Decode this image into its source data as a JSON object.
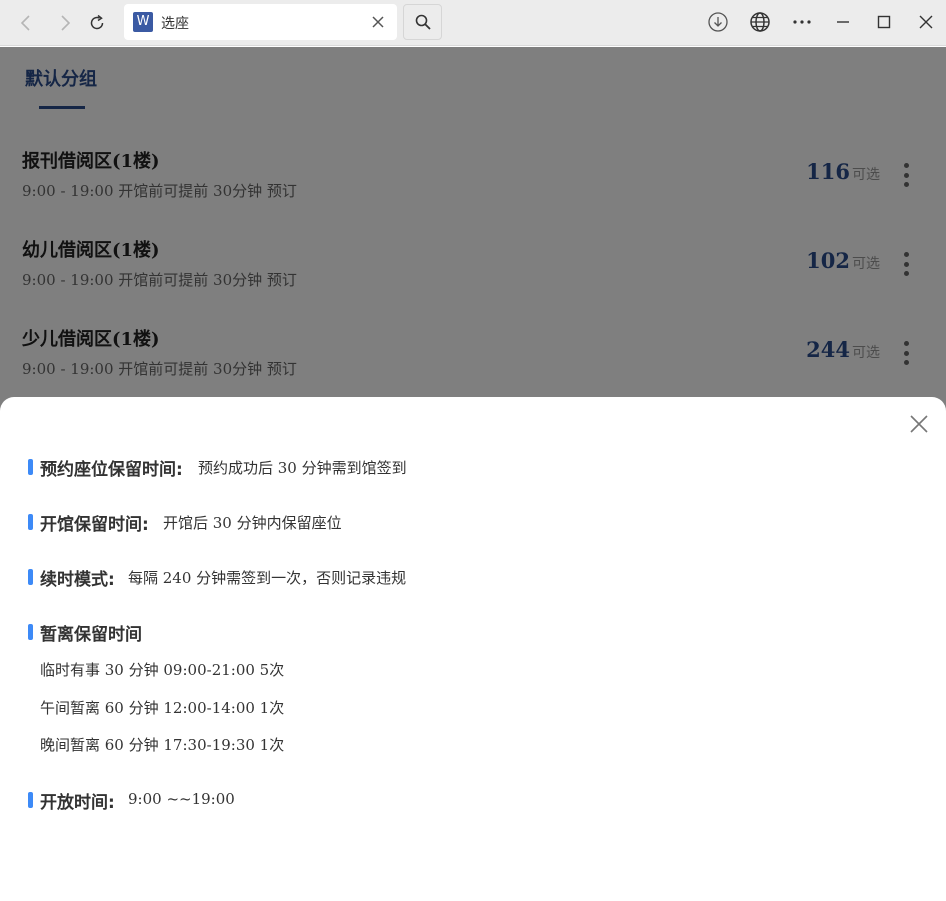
{
  "browser": {
    "tab_title": "选座",
    "favicon_text": "W",
    "icons": {
      "back": "chevron-left-icon",
      "forward": "chevron-right-icon",
      "refresh": "refresh-icon",
      "close_tab": "close-icon",
      "search": "search-icon",
      "download": "download-icon",
      "globe": "globe-icon",
      "more": "more-horizontal-icon",
      "minimize": "minimize-icon",
      "maximize": "maximize-icon",
      "close_window": "close-icon"
    }
  },
  "page": {
    "group_tab": "默认分组",
    "areas": [
      {
        "name": "报刊借阅区(1楼)",
        "hours": "9:00 - 19:00 开馆前可提前 30分钟 预订",
        "count": "116",
        "count_label": "可选"
      },
      {
        "name": "幼儿借阅区(1楼)",
        "hours": "9:00 - 19:00 开馆前可提前 30分钟 预订",
        "count": "102",
        "count_label": "可选"
      },
      {
        "name": "少儿借阅区(1楼)",
        "hours": "9:00 - 19:00 开馆前可提前 30分钟 预订",
        "count": "244",
        "count_label": "可选"
      }
    ]
  },
  "sheet": {
    "rules": [
      {
        "label": "预约座位保留时间:",
        "value": "预约成功后 30 分钟需到馆签到"
      },
      {
        "label": "开馆保留时间:",
        "value": "开馆后 30 分钟内保留座位"
      },
      {
        "label": "续时模式:",
        "value": "每隔 240 分钟需签到一次，否则记录违规"
      },
      {
        "label": "暂离保留时间",
        "value": ""
      },
      {
        "label": "开放时间:",
        "value": "9:00 ~~19:00"
      }
    ],
    "away_items": [
      "临时有事 30 分钟 09:00-21:00 5次",
      "午间暂离 60 分钟 12:00-14:00 1次",
      "晚间暂离 60 分钟 17:30-19:30 1次"
    ]
  },
  "colors": {
    "accent": "#2b4c8c",
    "rule_bar": "#3d8af7",
    "overlay": "rgba(0,0,0,0.5)"
  }
}
